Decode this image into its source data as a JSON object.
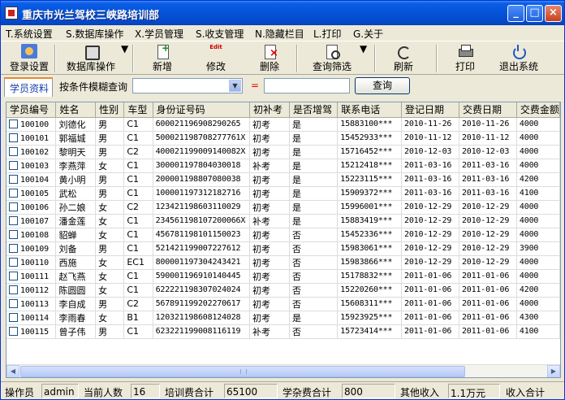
{
  "window": {
    "title": "重庆市光兰驾校三峡路培训部",
    "controls": {
      "minimize": "_",
      "maximize": "□",
      "close": "×"
    }
  },
  "menu": [
    {
      "key": "T",
      "label": "T.系统设置"
    },
    {
      "key": "S",
      "label": "S.数据库操作"
    },
    {
      "key": "X",
      "label": "X.学员管理"
    },
    {
      "key": "S",
      "label": "S.收支管理"
    },
    {
      "key": "N",
      "label": "N.隐藏栏目"
    },
    {
      "key": "L",
      "label": "L.打印"
    },
    {
      "key": "G",
      "label": "G.关于"
    }
  ],
  "toolbar": {
    "login": "登录设置",
    "database": "数据库操作",
    "new": "新增",
    "edit": "修改",
    "edit_icon_text": "Edit",
    "delete": "删除",
    "query_filter": "查询筛选",
    "refresh": "刷新",
    "print": "打印",
    "exit": "退出系统"
  },
  "search": {
    "tab": "学员资料",
    "label": "按条件模糊查询",
    "select_value": "",
    "equals": "=",
    "input_value": "",
    "button": "查询"
  },
  "table": {
    "columns": [
      "学员编号",
      "姓名",
      "性别",
      "车型",
      "身份证号码",
      "初补考",
      "是否增驾",
      "联系电话",
      "登记日期",
      "交费日期",
      "交费金额"
    ],
    "rows": [
      [
        "100100",
        "刘德化",
        "男",
        "C1",
        "600021196908290265",
        "初考",
        "是",
        "15883100***",
        "2010-11-26",
        "2010-11-26",
        "4000"
      ],
      [
        "100101",
        "郭福城",
        "男",
        "C1",
        "500021198708277761X",
        "初考",
        "是",
        "15452933***",
        "2010-11-12",
        "2010-11-12",
        "4000"
      ],
      [
        "100102",
        "黎明天",
        "男",
        "C2",
        "400021199009140082X",
        "初考",
        "是",
        "15716452***",
        "2010-12-03",
        "2010-12-03",
        "4000"
      ],
      [
        "100103",
        "李燕萍",
        "女",
        "C1",
        "300001197804030018",
        "补考",
        "是",
        "15212418***",
        "2011-03-16",
        "2011-03-16",
        "4000"
      ],
      [
        "100104",
        "黄小明",
        "男",
        "C1",
        "200001198807080038",
        "初考",
        "是",
        "15223115***",
        "2011-03-16",
        "2011-03-16",
        "4200"
      ],
      [
        "100105",
        "武松",
        "男",
        "C1",
        "100001197312182716",
        "初考",
        "是",
        "15909372***",
        "2011-03-16",
        "2011-03-16",
        "4100"
      ],
      [
        "100106",
        "孙二娘",
        "女",
        "C2",
        "123421198603110029",
        "初考",
        "是",
        "15996001***",
        "2010-12-29",
        "2010-12-29",
        "4000"
      ],
      [
        "100107",
        "潘金莲",
        "女",
        "C1",
        "234561198107200066X",
        "补考",
        "是",
        "15883419***",
        "2010-12-29",
        "2010-12-29",
        "4000"
      ],
      [
        "100108",
        "貂蝉",
        "女",
        "C1",
        "456781198101150023",
        "初考",
        "否",
        "15452336***",
        "2010-12-29",
        "2010-12-29",
        "4000"
      ],
      [
        "100109",
        "刘备",
        "男",
        "C1",
        "521421199007227612",
        "初考",
        "否",
        "15983061***",
        "2010-12-29",
        "2010-12-29",
        "3900"
      ],
      [
        "100110",
        "西施",
        "女",
        "EC1",
        "800001197304243421",
        "初考",
        "否",
        "15983866***",
        "2010-12-29",
        "2010-12-29",
        "4000"
      ],
      [
        "100111",
        "赵飞燕",
        "女",
        "C1",
        "590001196910140445",
        "初考",
        "否",
        "15178832***",
        "2011-01-06",
        "2011-01-06",
        "4000"
      ],
      [
        "100112",
        "陈圆圆",
        "女",
        "C1",
        "622221198307024024",
        "初考",
        "否",
        "15220260***",
        "2011-01-06",
        "2011-01-06",
        "4200"
      ],
      [
        "100113",
        "李自成",
        "男",
        "C2",
        "567891199202270617",
        "初考",
        "否",
        "15608311***",
        "2011-01-06",
        "2011-01-06",
        "4000"
      ],
      [
        "100114",
        "李雨春",
        "女",
        "B1",
        "120321198608124028",
        "初考",
        "是",
        "15923925***",
        "2011-01-06",
        "2011-01-06",
        "4300"
      ],
      [
        "100115",
        "曾子伟",
        "男",
        "C1",
        "623221199008116119",
        "补考",
        "否",
        "15723414***",
        "2011-01-06",
        "2011-01-06",
        "4100"
      ]
    ]
  },
  "status": {
    "operator_label": "操作员",
    "operator_value": "admin",
    "count_label": "当前人数",
    "count_value": "16",
    "training_fee_label": "培训费合计",
    "training_fee_value": "65100",
    "misc_fee_label": "学杂费合计",
    "misc_fee_value": "800",
    "other_income_label": "其他收入",
    "other_income_value": "1.1万元",
    "income_total_label": "收入合计"
  }
}
